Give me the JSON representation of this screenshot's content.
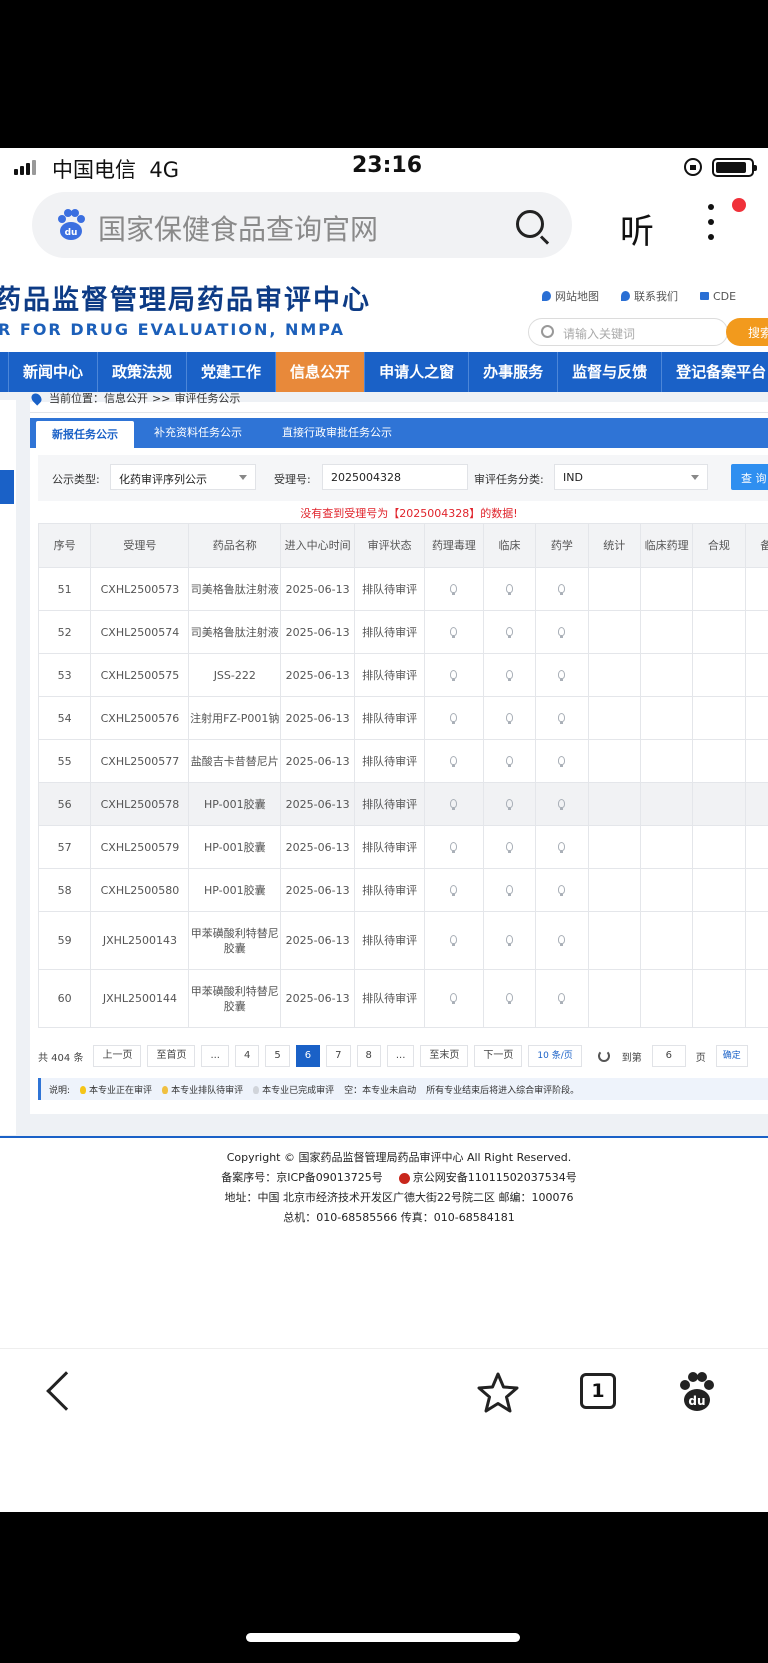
{
  "status": {
    "carrier": "中国电信",
    "network": "4G",
    "time": "23:16"
  },
  "browser": {
    "search_text": "国家保健食品查询官网",
    "listen_label": "听",
    "tab_count": "1"
  },
  "site": {
    "title": "药品监督管理局药品审评中心",
    "subtitle": "R FOR DRUG EVALUATION, NMPA",
    "links": [
      "网站地图",
      "联系我们",
      "CDE"
    ],
    "search_placeholder": "请输入关键词",
    "search_button": "搜索"
  },
  "nav": [
    "新闻中心",
    "政策法规",
    "党建工作",
    "信息公开",
    "申请人之窗",
    "办事服务",
    "监督与反馈",
    "登记备案平台"
  ],
  "nav_active": 3,
  "breadcrumb": {
    "prefix": "当前位置：信息公开",
    "sep": ">>",
    "current": "审评任务公示"
  },
  "tabs": [
    "新报任务公示",
    "补充资料任务公示",
    "直接行政审批任务公示"
  ],
  "filters": {
    "type_label": "公示类型:",
    "type_value": "化药审评序列公示",
    "accept_label": "受理号:",
    "accept_value": "2025004328",
    "category_label": "审评任务分类:",
    "category_value": "IND",
    "query_button": "查 询"
  },
  "not_found_msg": "没有查到受理号为【2025004328】的数据!",
  "table": {
    "headers": [
      "序号",
      "受理号",
      "药品名称",
      "进入中心时间",
      "审评状态",
      "药理毒理",
      "临床",
      "药学",
      "统计",
      "临床药理",
      "合规",
      "备注"
    ],
    "rows": [
      {
        "no": "51",
        "id": "CXHL2500573",
        "name": "司美格鲁肽注射液",
        "date": "2025-06-13",
        "status": "排队待审评"
      },
      {
        "no": "52",
        "id": "CXHL2500574",
        "name": "司美格鲁肽注射液",
        "date": "2025-06-13",
        "status": "排队待审评"
      },
      {
        "no": "53",
        "id": "CXHL2500575",
        "name": "JSS-222",
        "date": "2025-06-13",
        "status": "排队待审评"
      },
      {
        "no": "54",
        "id": "CXHL2500576",
        "name": "注射用FZ-P001钠",
        "date": "2025-06-13",
        "status": "排队待审评"
      },
      {
        "no": "55",
        "id": "CXHL2500577",
        "name": "盐酸吉卡昔替尼片",
        "date": "2025-06-13",
        "status": "排队待审评"
      },
      {
        "no": "56",
        "id": "CXHL2500578",
        "name": "HP-001胶囊",
        "date": "2025-06-13",
        "status": "排队待审评"
      },
      {
        "no": "57",
        "id": "CXHL2500579",
        "name": "HP-001胶囊",
        "date": "2025-06-13",
        "status": "排队待审评"
      },
      {
        "no": "58",
        "id": "CXHL2500580",
        "name": "HP-001胶囊",
        "date": "2025-06-13",
        "status": "排队待审评"
      },
      {
        "no": "59",
        "id": "JXHL2500143",
        "name": "甲苯磺酸利特替尼胶囊",
        "date": "2025-06-13",
        "status": "排队待审评"
      },
      {
        "no": "60",
        "id": "JXHL2500144",
        "name": "甲苯磺酸利特替尼胶囊",
        "date": "2025-06-13",
        "status": "排队待审评"
      }
    ]
  },
  "pager": {
    "total": "共 404 条",
    "prev": "上一页",
    "first": "至首页",
    "dots": "...",
    "pages": [
      "4",
      "5",
      "6",
      "7",
      "8"
    ],
    "current": "6",
    "last": "至末页",
    "next": "下一页",
    "per_page": "10 条/页",
    "goto_label": "到第",
    "goto_value": "6",
    "page_unit": "页",
    "confirm": "确定"
  },
  "legend": {
    "title": "说明:",
    "items": [
      "本专业正在审评",
      "本专业排队待审评",
      "本专业已完成审评"
    ],
    "empty_label": "空：本专业未启动",
    "note": "所有专业结束后将进入综合审评阶段。",
    "colors": [
      "#f5c518",
      "#f0c040",
      "#d0d4da"
    ]
  },
  "footer": {
    "line1": "Copyright © 国家药品监督管理局药品审评中心    All Right Reserved.",
    "icp": "备案序号：京ICP备09013725号",
    "police": "京公网安备11011502037534号",
    "address": "地址：中国 北京市经济技术开发区广德大街22号院二区      邮编：100076",
    "phone": "总机：010-68585566      传真：010-68584181"
  }
}
